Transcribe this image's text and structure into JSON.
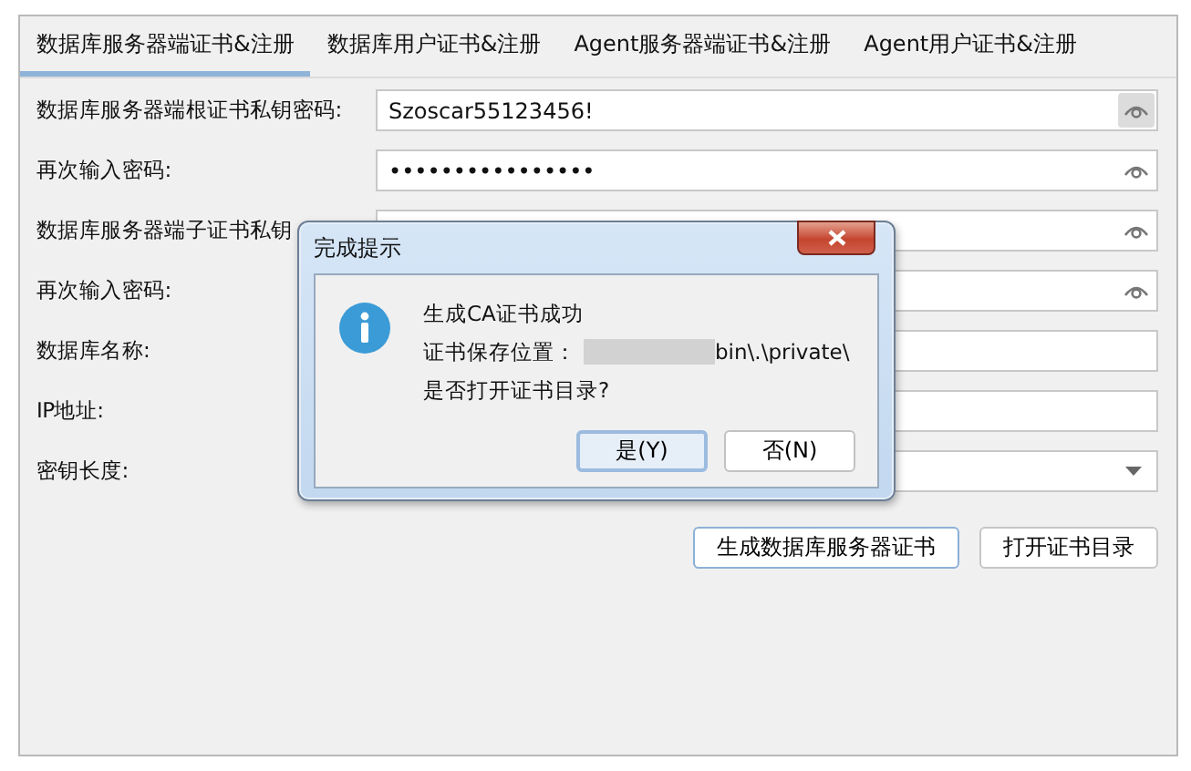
{
  "tabs": [
    {
      "label": "数据库服务器端证书&注册",
      "selected": true
    },
    {
      "label": "数据库用户证书&注册",
      "selected": false
    },
    {
      "label": "Agent服务器端证书&注册",
      "selected": false
    },
    {
      "label": "Agent用户证书&注册",
      "selected": false
    }
  ],
  "form": [
    {
      "kind": "password",
      "label": "数据库服务器端根证书私钥密码:",
      "value": "Szoscar55123456!",
      "revealed": true
    },
    {
      "kind": "password",
      "label": "再次输入密码:",
      "value": "••••••••••••••••",
      "revealed": false
    },
    {
      "kind": "password",
      "label": "数据库服务器端子证书私钥",
      "revealed": false
    },
    {
      "kind": "password",
      "label": "再次输入密码:",
      "revealed": false
    },
    {
      "kind": "text",
      "label": "数据库名称:"
    },
    {
      "kind": "text",
      "label": "IP地址:"
    },
    {
      "kind": "select",
      "label": "密钥长度:"
    }
  ],
  "actions": [
    {
      "label": "生成数据库服务器证书",
      "default": true
    },
    {
      "label": "打开证书目录",
      "default": false
    }
  ],
  "dialog": {
    "title": "完成提示",
    "lines": [
      {
        "kind": "plain",
        "text": "生成CA证书成功"
      },
      {
        "kind": "path",
        "label": "证书保存位置：",
        "value": "bin\\.\\private\\"
      },
      {
        "kind": "plain",
        "text": "是否打开证书目录?"
      }
    ],
    "buttons": [
      {
        "label": "是(Y)",
        "default": true
      },
      {
        "label": "否(N)",
        "default": false
      }
    ]
  }
}
